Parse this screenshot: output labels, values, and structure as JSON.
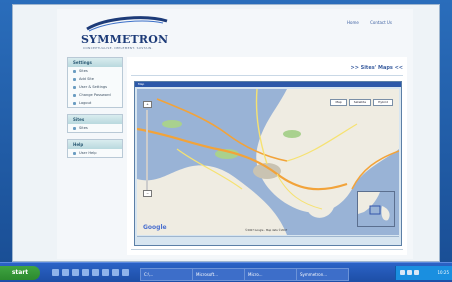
{
  "logo": {
    "name": "SYMMETRON",
    "tagline": "CONCEPTUALISE. IMPLEMENT. SUSTAIN."
  },
  "top_links": {
    "home": "Home",
    "contact": "Contact Us",
    "right_mark": "x"
  },
  "sidebar": {
    "settings": {
      "header": "Settings",
      "items": [
        "Sites",
        "Add Site",
        "User & Settings",
        "Change Password",
        "Logout"
      ]
    },
    "sites": {
      "header": "Sites",
      "items": [
        "Sites"
      ]
    },
    "help": {
      "header": "Help",
      "items": [
        "User Help"
      ]
    }
  },
  "content": {
    "title": ">> Sites' Maps <<"
  },
  "map": {
    "window_title": "Map",
    "types": [
      "Map",
      "Satellite",
      "Hybrid"
    ],
    "google_label": "Google",
    "copyright": "©2007 Google - Map data ©2007"
  },
  "taskbar": {
    "start_label": "start",
    "items": [
      "C:\\...",
      "Microsoft...",
      "Micro...",
      "Symmetron..."
    ],
    "clock": "10:25"
  },
  "colors": {
    "accent": "#2c58a9",
    "map_water": "#99b3d6",
    "map_land": "#efece2",
    "road_orange": "#f2a33a",
    "road_yellow": "#f6e271",
    "park_green": "#a9d18e"
  }
}
